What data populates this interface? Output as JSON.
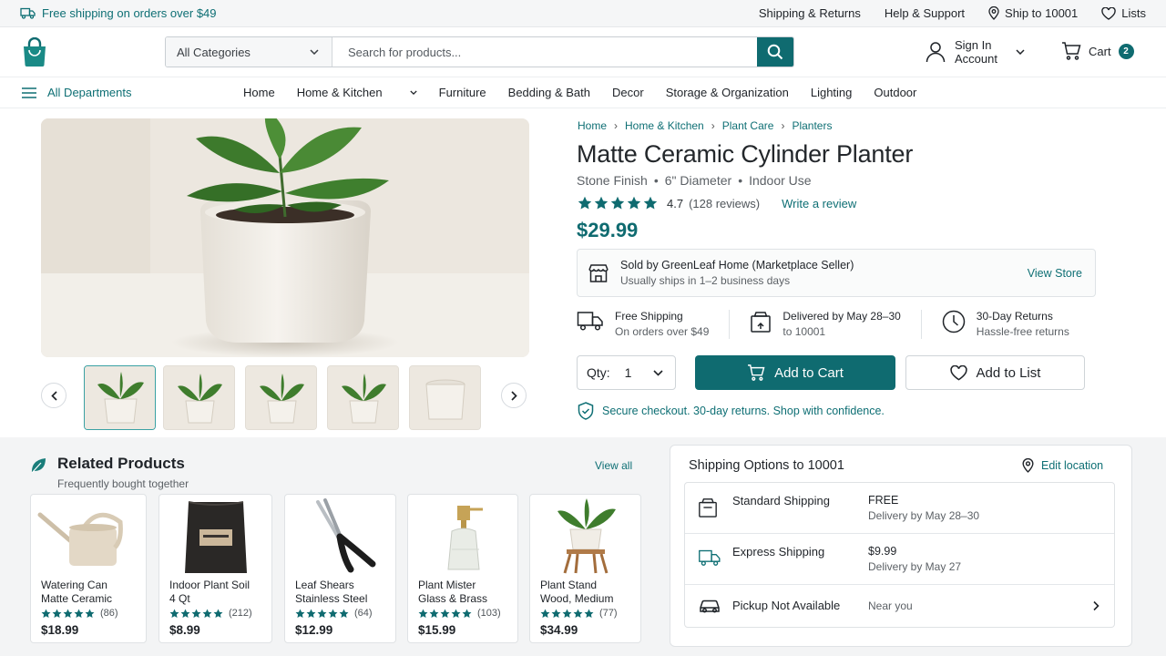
{
  "topbar": {
    "promo": "Free shipping on orders over $49",
    "links": [
      "Shipping & Returns",
      "Help & Support",
      "Ship to 10001",
      "Lists"
    ]
  },
  "header": {
    "category_select": "All Categories",
    "search_placeholder": "Search for products...",
    "account_line1": "Sign In",
    "account_line2": "Account",
    "cart_label": "Cart",
    "cart_count": "2"
  },
  "nav": {
    "departments": "All Departments",
    "items": [
      "Home",
      "Home & Kitchen",
      "Furniture",
      "Bedding & Bath",
      "Decor",
      "Storage & Organization",
      "Lighting",
      "Outdoor"
    ]
  },
  "breadcrumb": [
    "Home",
    "Home & Kitchen",
    "Plant Care",
    "Planters"
  ],
  "product": {
    "title": "Matte Ceramic Cylinder Planter",
    "attributes": [
      "Stone Finish",
      "6\" Diameter",
      "Indoor Use"
    ],
    "rating": "4.7",
    "reviews": "(128 reviews)",
    "write_review": "Write a review",
    "price": "$29.99",
    "stars": 4.7
  },
  "seller": {
    "line1": "Sold by GreenLeaf Home (Marketplace Seller)",
    "line2": "Usually ships in 1–2 business days",
    "view_store": "View Store"
  },
  "perks": [
    {
      "title": "Free Shipping",
      "sub": "On orders over $49",
      "icon": "truck-icon"
    },
    {
      "title": "Delivered by May 28–30",
      "sub": "to 10001",
      "icon": "package-icon"
    },
    {
      "title": "30-Day Returns",
      "sub": "Hassle-free returns",
      "icon": "clock-icon"
    }
  ],
  "purchase": {
    "qty_label": "Qty:",
    "qty_value": "1",
    "add_to_cart": "Add to Cart",
    "add_to_list": "Add to List",
    "secure": "Secure checkout. 30-day returns. Shop with confidence."
  },
  "related": {
    "title": "Related Products",
    "subtitle": "Frequently bought together",
    "view_all": "View all",
    "items": [
      {
        "line1": "Watering Can",
        "line2": "Matte Ceramic",
        "count": "(86)",
        "price": "$18.99"
      },
      {
        "line1": "Indoor Plant Soil",
        "line2": "4 Qt",
        "count": "(212)",
        "price": "$8.99"
      },
      {
        "line1": "Leaf Shears",
        "line2": "Stainless Steel",
        "count": "(64)",
        "price": "$12.99"
      },
      {
        "line1": "Plant Mister",
        "line2": "Glass & Brass",
        "count": "(103)",
        "price": "$15.99"
      },
      {
        "line1": "Plant Stand",
        "line2": "Wood, Medium",
        "count": "(77)",
        "price": "$34.99"
      }
    ]
  },
  "shipping": {
    "title": "Shipping Options to 10001",
    "edit": "Edit location",
    "options": [
      {
        "name": "Standard Shipping",
        "value": "FREE",
        "sub": "Delivery by May 28–30"
      },
      {
        "name": "Express Shipping",
        "value": "$9.99",
        "sub": "Delivery by May 27"
      },
      {
        "name": "Pickup Not Available",
        "value": "Near you",
        "sub": ""
      }
    ]
  },
  "colors": {
    "brand": "#0f6b70",
    "accent_text": "#0e6f74",
    "star": "#0f6b70"
  }
}
